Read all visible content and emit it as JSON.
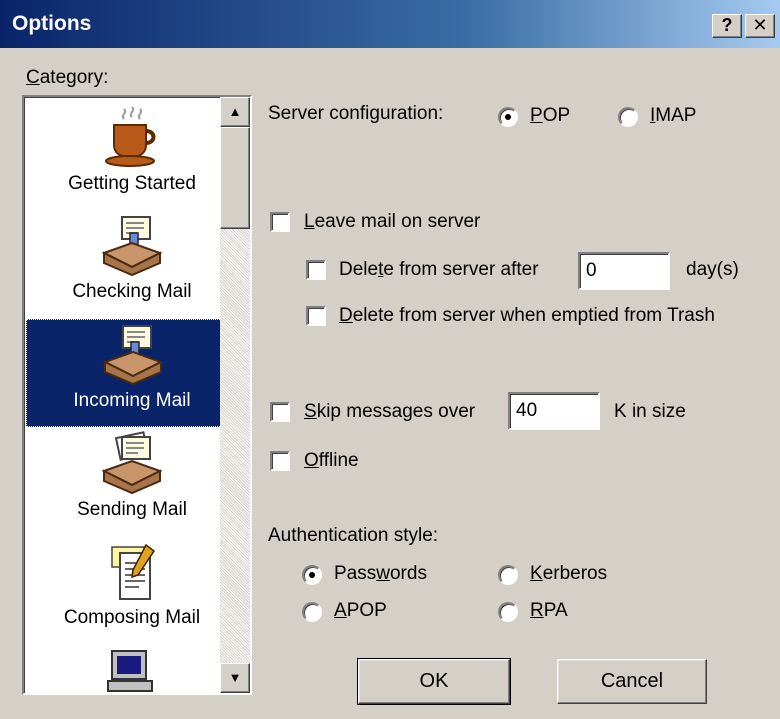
{
  "window": {
    "title": "Options",
    "help_button": "?",
    "close_button": "✕"
  },
  "category": {
    "label_prefix": "",
    "label_accel": "C",
    "label_rest": "ategory:",
    "items": [
      {
        "label": "Getting Started",
        "icon": "coffee-cup-icon",
        "selected": false
      },
      {
        "label": "Checking Mail",
        "icon": "mailbox-icon",
        "selected": false
      },
      {
        "label": "Incoming Mail",
        "icon": "mailbox-icon",
        "selected": true
      },
      {
        "label": "Sending Mail",
        "icon": "outbox-icon",
        "selected": false
      },
      {
        "label": "Composing Mail",
        "icon": "compose-icon",
        "selected": false
      },
      {
        "label": "",
        "icon": "computer-icon",
        "selected": false
      }
    ]
  },
  "server_config": {
    "label": "Server configuration:",
    "pop": {
      "pre": "",
      "accel": "P",
      "post": "OP",
      "selected": true
    },
    "imap": {
      "pre": "",
      "accel": "I",
      "post": "MAP",
      "selected": false
    }
  },
  "leave_mail": {
    "pre": "",
    "accel": "L",
    "post": "eave mail on server",
    "checked": false
  },
  "delete_after": {
    "pre": "Dele",
    "accel": "t",
    "post": "e from server after",
    "checked": false,
    "value": "0",
    "unit": "day(s)"
  },
  "delete_emptied": {
    "pre": "",
    "accel": "D",
    "post": "elete from server when emptied from Trash",
    "checked": false
  },
  "skip_messages": {
    "pre": "",
    "accel": "S",
    "post": "kip messages over",
    "checked": false,
    "value": "40",
    "unit": "K in size"
  },
  "offline": {
    "pre": "",
    "accel": "O",
    "post": "ffline",
    "checked": false
  },
  "auth": {
    "label": "Authentication style:",
    "passwords": {
      "pre": "Pass",
      "accel": "w",
      "post": "ords",
      "selected": true
    },
    "kerberos": {
      "pre": "",
      "accel": "K",
      "post": "erberos",
      "selected": false
    },
    "apop": {
      "pre": "",
      "accel": "A",
      "post": "POP",
      "selected": false
    },
    "rpa": {
      "pre": "",
      "accel": "R",
      "post": "PA",
      "selected": false
    }
  },
  "buttons": {
    "ok": "OK",
    "cancel": "Cancel"
  },
  "colors": {
    "titlebar": "#0a246a",
    "face": "#d4d0c8",
    "selection": "#0a246a"
  }
}
